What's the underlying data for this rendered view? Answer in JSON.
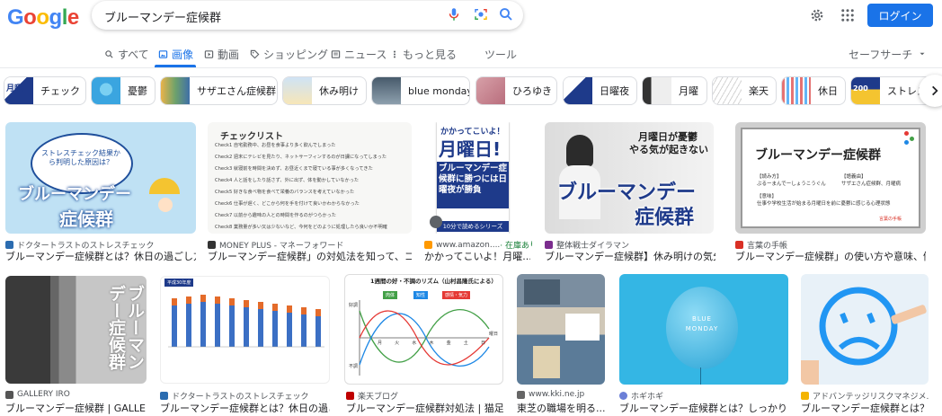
{
  "header": {
    "logo": "Google",
    "search_value": "ブルーマンデー症候群",
    "login_label": "ログイン"
  },
  "nav": {
    "all": "すべて",
    "images": "画像",
    "videos": "動画",
    "shopping": "ショッピング",
    "news": "ニュース",
    "more": "もっと見る",
    "tools": "ツール",
    "safesearch": "セーフサーチ"
  },
  "chips": [
    "チェック",
    "憂鬱",
    "サザエさん症候群",
    "休み明け",
    "blue monday",
    "ひろゆき",
    "日曜夜",
    "月曜",
    "楽天",
    "休日",
    "ストレス"
  ],
  "results": [
    {
      "source": "ドクタートラストのストレスチェック",
      "title": "ブルーマンデー症候群とは？休日の過ごし方...",
      "favicon": "#2b6cb0"
    },
    {
      "source": "MONEY PLUS - マネーフォワード",
      "title": "ブルーマンデー症候群」の対処法を知って、コ...",
      "favicon": "#333333"
    },
    {
      "source": "www.amazon....",
      "badge": "· 在庫あり",
      "title": "かかってこいよ！月曜...",
      "favicon": "#ff9900"
    },
    {
      "source": "整体戦士ダイラマン",
      "title": "ブルーマンデー症候群】休み明けの気分...",
      "favicon": "#7b2d8e"
    },
    {
      "source": "言葉の手帳",
      "title": "ブルーマンデー症候群」の使い方や意味、例...",
      "favicon": "#d93025"
    },
    {
      "source": "GALLERY IRO",
      "title": "ブルーマンデー症候群 | GALLER...",
      "favicon": "#555555"
    },
    {
      "source": "ドクタートラストのストレスチェック",
      "title": "ブルーマンデー症候群とは？休日の過ご...",
      "favicon": "#2b6cb0"
    },
    {
      "source": "楽天ブログ",
      "title": "ブルーマンデー症候群対処法 | 猫足...",
      "favicon": "#bf0000"
    },
    {
      "source": "www.kki.ne.jp",
      "title": "東芝の職場を明る...",
      "favicon": "#666666"
    },
    {
      "source": "ホギホギ",
      "title": "ブルーマンデー症候群とは？しっかり...",
      "favicon": "#6b7fd7"
    },
    {
      "source": "アドバンテッジリスクマネジメ...",
      "title": "ブルーマンデー症候群とは？考...",
      "favicon": "#f4b400"
    }
  ],
  "thumb_text": {
    "t1_circle": "ストレスチェック結果から判明した原因は？",
    "t1_main": "ブルーマンデー",
    "t1_main2": "症候群",
    "t2_heading": "チェックリスト",
    "t2_items": [
      "Check1 自宅勤務中、お昼を食事より多く飲んでしまった",
      "Check2 週末にテレビを見たり、ネットサーフィンするのが日課になってしまった",
      "Check3 就寝前を時間を決めず、お昼近くまで寝ている事が多くなってきた",
      "Check4 人と話をしたり話さず、外に出ず、体を動かしていなかった",
      "Check5 好きな食べ物を食べて栄養のバランスを考えていなかった",
      "Check6 仕事が遅く、どこから何を手を付けて良いかわからなかった",
      "Check7 以前から趣味の人との時間を作るのがつらかった",
      "Check8 業務量が多い又は少ないなど、今何をどのように処理したら良いか不明確"
    ],
    "t3_top": "かかってこいよ！",
    "t3_big": "月曜日!",
    "t3_sub": "ブルーマンデー症候群に勝つには日曜夜が勝負",
    "t3_band": "10分で読めるシリーズ",
    "t4_top": "月曜日が憂鬱",
    "t4_top2": "やる気が起きない",
    "t4_main": "ブルーマンデー",
    "t4_main2": "症候群",
    "t5_title": "ブルーマンデー症候群",
    "t5_reading_label": "【読み方】",
    "t5_reading": "ぶるーまんでーしょうこうぐん",
    "t5_origin_label": "【語義由】",
    "t5_origin": "サザエさん症候群、月曜病",
    "t5_meaning_label": "【意味】",
    "t5_meaning": "仕事や学校生活が始まる月曜日を前に憂鬱に感じる心理状態",
    "t5_brand": "言葉の手帳",
    "t6_big": "ブルーマンデー症候群",
    "t7_header": "平成30年度",
    "t8_title": "1週間の好・不調のリズム（山村昌隆氏による）",
    "t8_legend1": "肉体",
    "t8_legend2": "知性",
    "t8_legend3": "感情・気力",
    "t8_days": [
      "月",
      "火",
      "水",
      "木",
      "金",
      "土",
      "日"
    ],
    "t8_axis": "曜日",
    "t8_good": "好調",
    "t8_bad": "不調",
    "t10_line1": "BLUE",
    "t10_line2": "MONDAY"
  }
}
